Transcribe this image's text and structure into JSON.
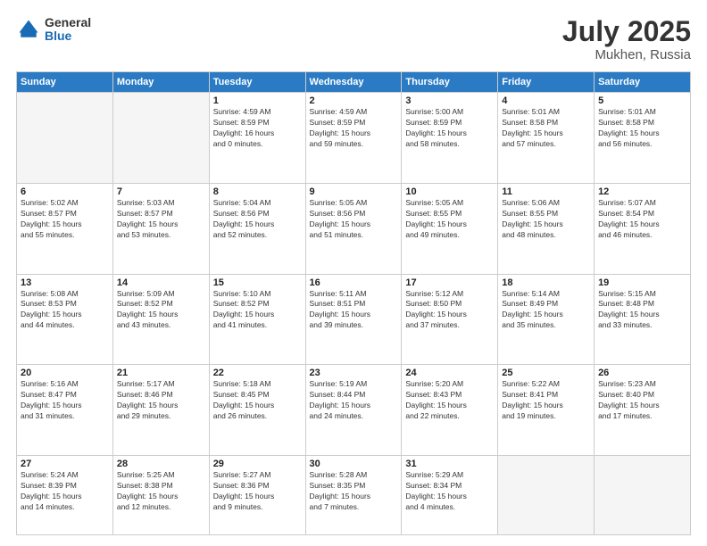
{
  "header": {
    "logo_general": "General",
    "logo_blue": "Blue",
    "month_year": "July 2025",
    "location": "Mukhen, Russia"
  },
  "weekdays": [
    "Sunday",
    "Monday",
    "Tuesday",
    "Wednesday",
    "Thursday",
    "Friday",
    "Saturday"
  ],
  "days": [
    {
      "num": "",
      "info": ""
    },
    {
      "num": "",
      "info": ""
    },
    {
      "num": "1",
      "info": "Sunrise: 4:59 AM\nSunset: 8:59 PM\nDaylight: 16 hours\nand 0 minutes."
    },
    {
      "num": "2",
      "info": "Sunrise: 4:59 AM\nSunset: 8:59 PM\nDaylight: 15 hours\nand 59 minutes."
    },
    {
      "num": "3",
      "info": "Sunrise: 5:00 AM\nSunset: 8:59 PM\nDaylight: 15 hours\nand 58 minutes."
    },
    {
      "num": "4",
      "info": "Sunrise: 5:01 AM\nSunset: 8:58 PM\nDaylight: 15 hours\nand 57 minutes."
    },
    {
      "num": "5",
      "info": "Sunrise: 5:01 AM\nSunset: 8:58 PM\nDaylight: 15 hours\nand 56 minutes."
    },
    {
      "num": "6",
      "info": "Sunrise: 5:02 AM\nSunset: 8:57 PM\nDaylight: 15 hours\nand 55 minutes."
    },
    {
      "num": "7",
      "info": "Sunrise: 5:03 AM\nSunset: 8:57 PM\nDaylight: 15 hours\nand 53 minutes."
    },
    {
      "num": "8",
      "info": "Sunrise: 5:04 AM\nSunset: 8:56 PM\nDaylight: 15 hours\nand 52 minutes."
    },
    {
      "num": "9",
      "info": "Sunrise: 5:05 AM\nSunset: 8:56 PM\nDaylight: 15 hours\nand 51 minutes."
    },
    {
      "num": "10",
      "info": "Sunrise: 5:05 AM\nSunset: 8:55 PM\nDaylight: 15 hours\nand 49 minutes."
    },
    {
      "num": "11",
      "info": "Sunrise: 5:06 AM\nSunset: 8:55 PM\nDaylight: 15 hours\nand 48 minutes."
    },
    {
      "num": "12",
      "info": "Sunrise: 5:07 AM\nSunset: 8:54 PM\nDaylight: 15 hours\nand 46 minutes."
    },
    {
      "num": "13",
      "info": "Sunrise: 5:08 AM\nSunset: 8:53 PM\nDaylight: 15 hours\nand 44 minutes."
    },
    {
      "num": "14",
      "info": "Sunrise: 5:09 AM\nSunset: 8:52 PM\nDaylight: 15 hours\nand 43 minutes."
    },
    {
      "num": "15",
      "info": "Sunrise: 5:10 AM\nSunset: 8:52 PM\nDaylight: 15 hours\nand 41 minutes."
    },
    {
      "num": "16",
      "info": "Sunrise: 5:11 AM\nSunset: 8:51 PM\nDaylight: 15 hours\nand 39 minutes."
    },
    {
      "num": "17",
      "info": "Sunrise: 5:12 AM\nSunset: 8:50 PM\nDaylight: 15 hours\nand 37 minutes."
    },
    {
      "num": "18",
      "info": "Sunrise: 5:14 AM\nSunset: 8:49 PM\nDaylight: 15 hours\nand 35 minutes."
    },
    {
      "num": "19",
      "info": "Sunrise: 5:15 AM\nSunset: 8:48 PM\nDaylight: 15 hours\nand 33 minutes."
    },
    {
      "num": "20",
      "info": "Sunrise: 5:16 AM\nSunset: 8:47 PM\nDaylight: 15 hours\nand 31 minutes."
    },
    {
      "num": "21",
      "info": "Sunrise: 5:17 AM\nSunset: 8:46 PM\nDaylight: 15 hours\nand 29 minutes."
    },
    {
      "num": "22",
      "info": "Sunrise: 5:18 AM\nSunset: 8:45 PM\nDaylight: 15 hours\nand 26 minutes."
    },
    {
      "num": "23",
      "info": "Sunrise: 5:19 AM\nSunset: 8:44 PM\nDaylight: 15 hours\nand 24 minutes."
    },
    {
      "num": "24",
      "info": "Sunrise: 5:20 AM\nSunset: 8:43 PM\nDaylight: 15 hours\nand 22 minutes."
    },
    {
      "num": "25",
      "info": "Sunrise: 5:22 AM\nSunset: 8:41 PM\nDaylight: 15 hours\nand 19 minutes."
    },
    {
      "num": "26",
      "info": "Sunrise: 5:23 AM\nSunset: 8:40 PM\nDaylight: 15 hours\nand 17 minutes."
    },
    {
      "num": "27",
      "info": "Sunrise: 5:24 AM\nSunset: 8:39 PM\nDaylight: 15 hours\nand 14 minutes."
    },
    {
      "num": "28",
      "info": "Sunrise: 5:25 AM\nSunset: 8:38 PM\nDaylight: 15 hours\nand 12 minutes."
    },
    {
      "num": "29",
      "info": "Sunrise: 5:27 AM\nSunset: 8:36 PM\nDaylight: 15 hours\nand 9 minutes."
    },
    {
      "num": "30",
      "info": "Sunrise: 5:28 AM\nSunset: 8:35 PM\nDaylight: 15 hours\nand 7 minutes."
    },
    {
      "num": "31",
      "info": "Sunrise: 5:29 AM\nSunset: 8:34 PM\nDaylight: 15 hours\nand 4 minutes."
    },
    {
      "num": "",
      "info": ""
    },
    {
      "num": "",
      "info": ""
    }
  ]
}
